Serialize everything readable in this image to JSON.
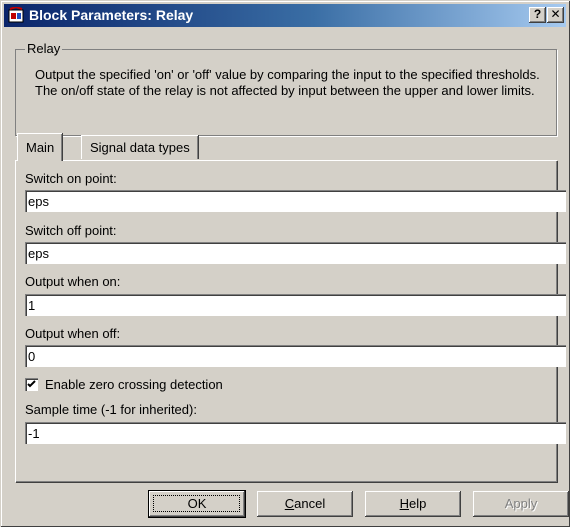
{
  "window": {
    "title": "Block Parameters: Relay",
    "help_button": "?",
    "close_button": "✕"
  },
  "group": {
    "label": "Relay",
    "description": "Output the specified 'on' or 'off' value by comparing the input to the specified thresholds.  The on/off state of the relay is not affected by input between the upper and lower limits."
  },
  "tabs": [
    {
      "label": "Main",
      "active": true
    },
    {
      "label": "Signal data types",
      "active": false
    }
  ],
  "fields": {
    "switch_on": {
      "label": "Switch on point:",
      "value": "eps"
    },
    "switch_off": {
      "label": "Switch off point:",
      "value": "eps"
    },
    "output_on": {
      "label": "Output when on:",
      "value": "1"
    },
    "output_off": {
      "label": "Output when off:",
      "value": "0"
    },
    "zero_crossing": {
      "label": "Enable zero crossing detection",
      "checked": true
    },
    "sample_time": {
      "label": "Sample time (-1 for inherited):",
      "value": "-1"
    }
  },
  "buttons": {
    "ok": "OK",
    "cancel_mnemonic": "C",
    "cancel_rest": "ancel",
    "help_mnemonic": "H",
    "help_rest": "elp",
    "apply": "Apply"
  },
  "colors": {
    "dialog_face": "#d4d0c8",
    "titlebar_start": "#0a246a",
    "titlebar_end": "#a6caf0"
  }
}
